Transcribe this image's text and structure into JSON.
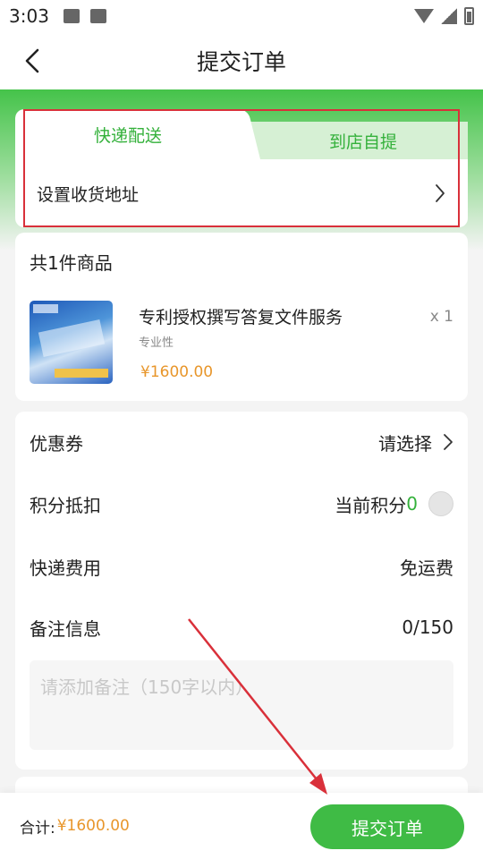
{
  "status_bar": {
    "time": "3:03"
  },
  "nav": {
    "title": "提交订单"
  },
  "delivery": {
    "tabs": [
      {
        "label": "快递配送",
        "active": true
      },
      {
        "label": "到店自提",
        "active": false
      }
    ],
    "address_label": "设置收货地址"
  },
  "goods": {
    "count_label": "共1件商品",
    "items": [
      {
        "name": "专利授权撰写答复文件服务",
        "quantity": "x 1",
        "tag": "专业性",
        "price": "¥1600.00"
      }
    ]
  },
  "options": {
    "coupon": {
      "label": "优惠券",
      "value": "请选择"
    },
    "points": {
      "label": "积分抵扣",
      "value_prefix": "当前积分",
      "value": "0"
    },
    "shipping": {
      "label": "快递费用",
      "value": "免运费"
    },
    "remark": {
      "label": "备注信息",
      "counter": "0/150",
      "placeholder": "请添加备注（150字以内）"
    }
  },
  "footer": {
    "total_label": "合计:",
    "total_value": "¥1600.00",
    "submit_label": "提交订单"
  },
  "colors": {
    "accent_green": "#3fbb45",
    "price_orange": "#e8962b",
    "annotation_red": "#d9303a"
  }
}
